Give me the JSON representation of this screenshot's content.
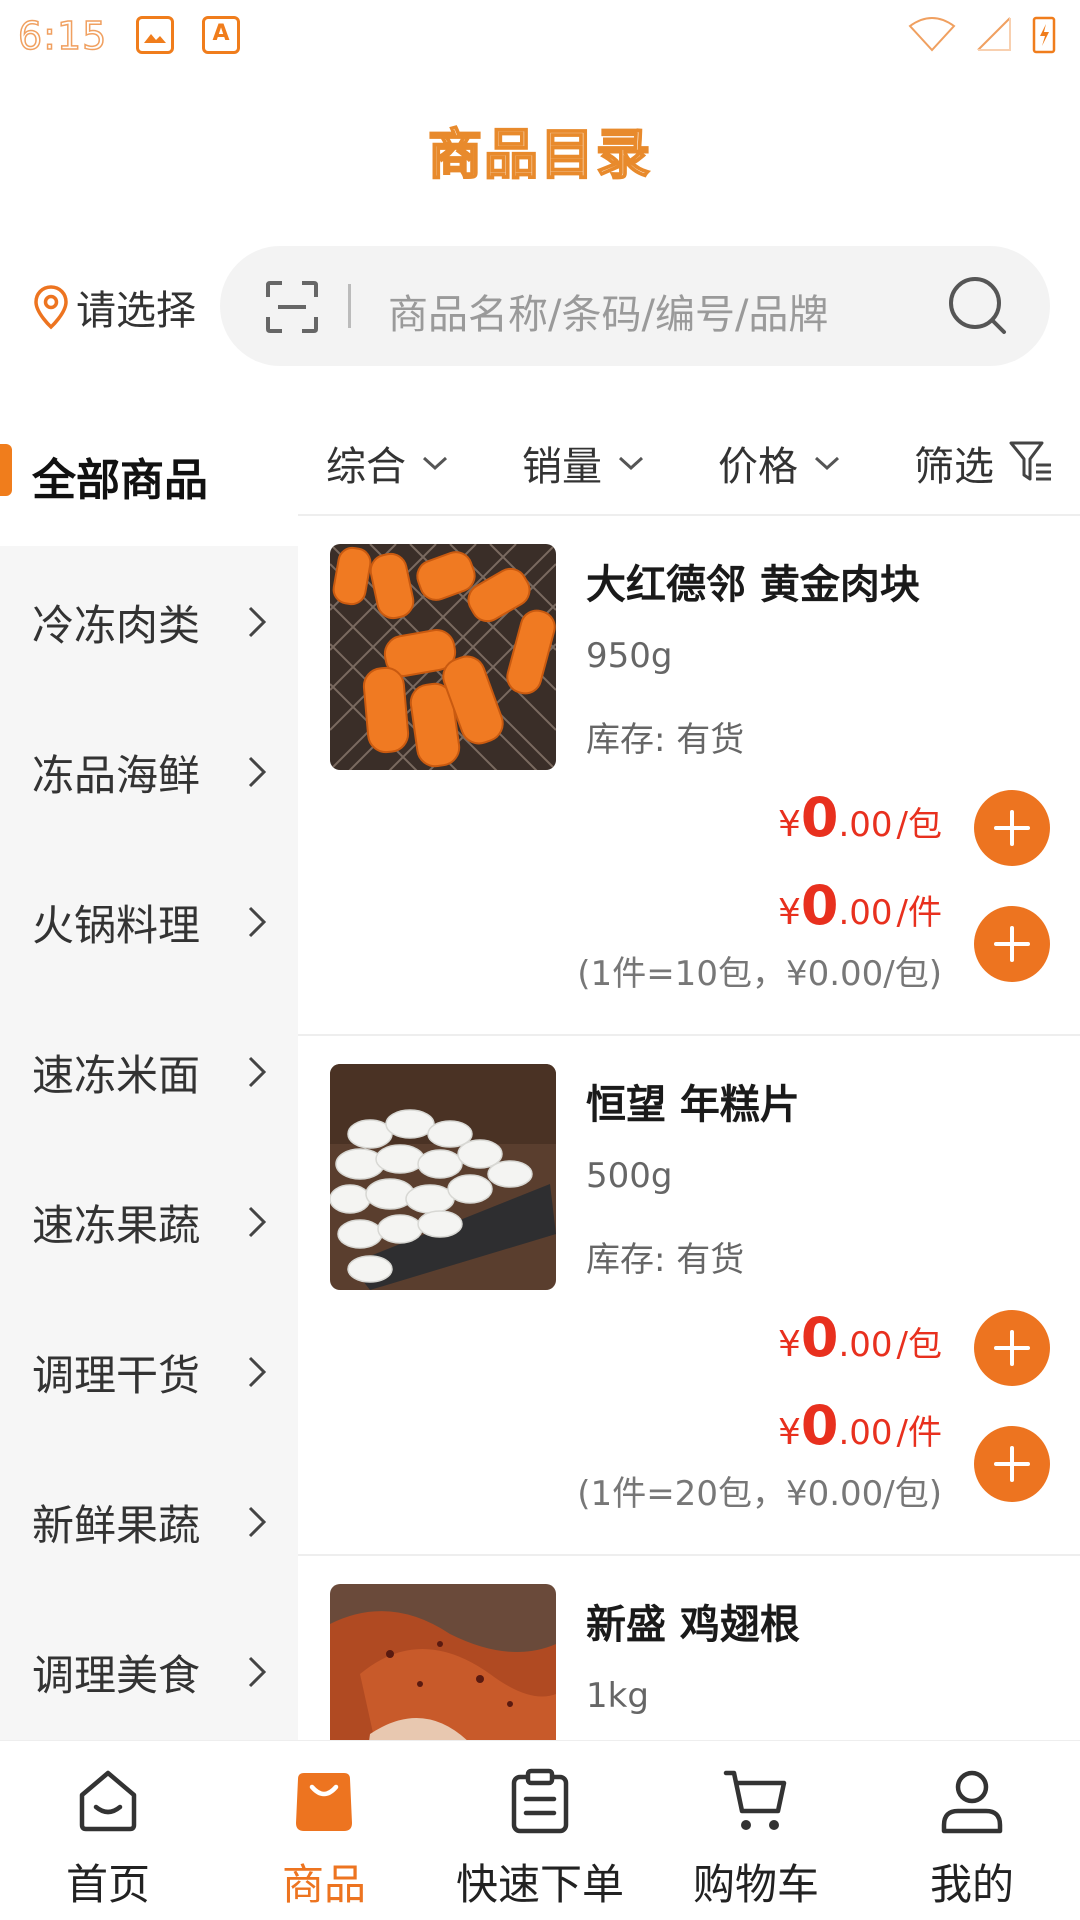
{
  "status_bar": {
    "time": "6:15"
  },
  "header": {
    "title": "商品目录"
  },
  "location": {
    "label": "请选择"
  },
  "search": {
    "placeholder": "商品名称/条码/编号/品牌"
  },
  "sidebar": {
    "active": "全部商品",
    "items": [
      "冷冻肉类",
      "冻品海鲜",
      "火锅料理",
      "速冻米面",
      "速冻果蔬",
      "调理干货",
      "新鲜果蔬",
      "调理美食"
    ]
  },
  "sort": {
    "items": [
      {
        "label": "综合",
        "icon": "chevron-down-icon"
      },
      {
        "label": "销量",
        "icon": "chevron-down-icon"
      },
      {
        "label": "价格",
        "icon": "chevron-down-icon"
      },
      {
        "label": "筛选",
        "icon": "filter-icon"
      }
    ]
  },
  "products": [
    {
      "name": "大红德邻 黄金肉块",
      "spec": "950g",
      "stock": "库存: 有货",
      "price1": {
        "yen": "¥",
        "int": "0",
        "dec": ".00",
        "unit": "/包"
      },
      "price2": {
        "yen": "¥",
        "int": "0",
        "dec": ".00",
        "unit": "/件"
      },
      "note": "(1件=10包，¥0.00/包)"
    },
    {
      "name": "恒望 年糕片",
      "spec": "500g",
      "stock": "库存: 有货",
      "price1": {
        "yen": "¥",
        "int": "0",
        "dec": ".00",
        "unit": "/包"
      },
      "price2": {
        "yen": "¥",
        "int": "0",
        "dec": ".00",
        "unit": "/件"
      },
      "note": "(1件=20包，¥0.00/包)"
    },
    {
      "name": "新盛 鸡翅根",
      "spec": "1kg"
    }
  ],
  "tabbar": {
    "items": [
      {
        "label": "首页",
        "icon": "home-icon"
      },
      {
        "label": "商品",
        "icon": "shopping-bag-icon",
        "active": true
      },
      {
        "label": "快速下单",
        "icon": "clipboard-icon"
      },
      {
        "label": "购物车",
        "icon": "cart-icon"
      },
      {
        "label": "我的",
        "icon": "user-icon"
      }
    ]
  },
  "colors": {
    "accent": "#ed7420",
    "price": "#e8301e"
  }
}
